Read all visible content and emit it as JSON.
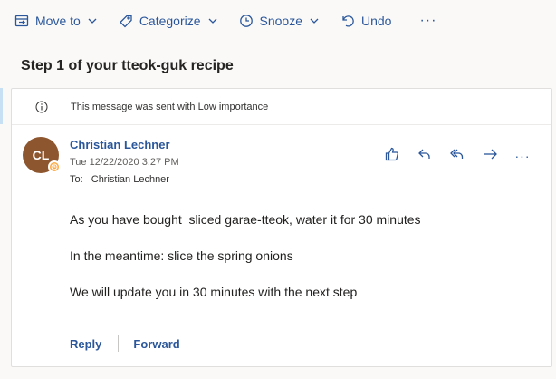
{
  "toolbar": {
    "move_to": "Move to",
    "categorize": "Categorize",
    "snooze": "Snooze",
    "undo": "Undo",
    "more": "···"
  },
  "subject": "Step 1 of your tteok-guk recipe",
  "importance_notice": "This message was sent with Low importance",
  "sender": {
    "initials": "CL",
    "name": "Christian Lechner",
    "date": "Tue 12/22/2020 3:27 PM",
    "to_label": "To:",
    "to_name": "Christian Lechner",
    "avatar_color": "#8e562e"
  },
  "message_actions": {
    "more": "···"
  },
  "body": {
    "line1": "As you have bought  sliced garae-tteok, water it for 30 minutes",
    "line2": "In the meantime: slice the spring onions",
    "line3": "We will update you in 30 minutes with the next step"
  },
  "footer": {
    "reply": "Reply",
    "forward": "Forward"
  },
  "colors": {
    "accent": "#2b579a",
    "presence_away": "#ffaa44"
  }
}
